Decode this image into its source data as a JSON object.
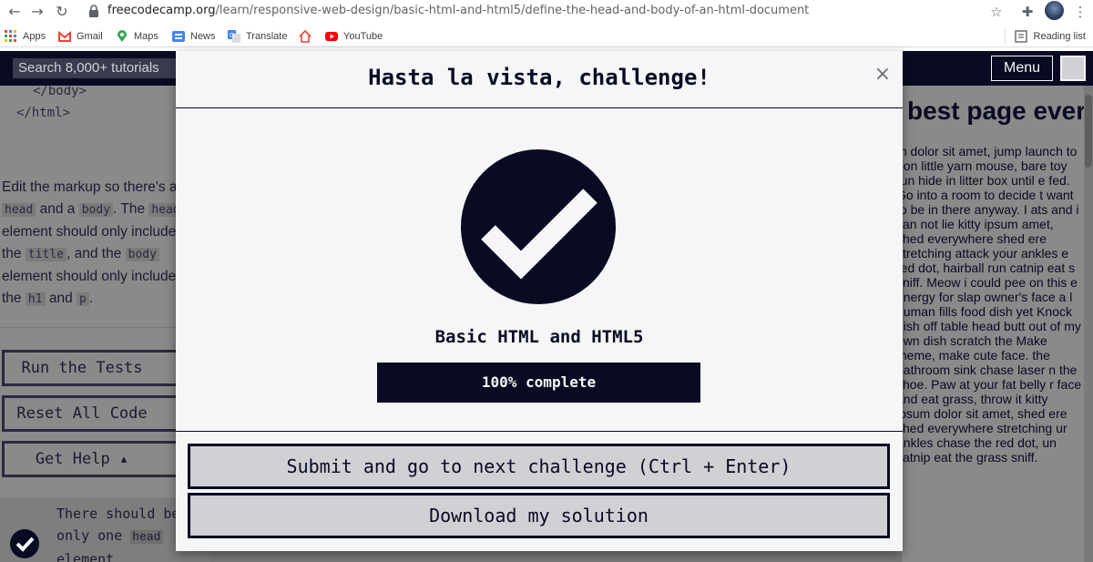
{
  "browser": {
    "url_host": "freecodecamp.org",
    "url_path": "/learn/responsive-web-design/basic-html-and-html5/define-the-head-and-body-of-an-html-document",
    "bookmarks": [
      {
        "label": "Apps",
        "icon": "apps-grid-icon"
      },
      {
        "label": "Gmail",
        "icon": "gmail-icon"
      },
      {
        "label": "Maps",
        "icon": "maps-pin-icon"
      },
      {
        "label": "News",
        "icon": "news-icon"
      },
      {
        "label": "Translate",
        "icon": "translate-icon"
      },
      {
        "label": "",
        "icon": "home-icon"
      },
      {
        "label": "YouTube",
        "icon": "youtube-icon"
      }
    ],
    "reading_list": "Reading list"
  },
  "fcc": {
    "search_placeholder": "Search 8,000+ tutorials",
    "menu_label": "Menu",
    "code_lines": [
      "</body>",
      "</html>"
    ],
    "instructions": {
      "t1": "Edit the markup so there's a ",
      "c1": "head",
      "t2": " and a ",
      "c2": "body",
      "t3": ". The ",
      "c3": "head",
      "t4": " element should only include the ",
      "c4": "title",
      "t5": ", and the ",
      "c5": "body",
      "t6": " element should only include the ",
      "c6": "h1",
      "t7": " and ",
      "c7": "p",
      "t8": "."
    },
    "buttons": {
      "run_tests": "Run the Tests",
      "reset": "Reset All Code",
      "help": "Get Help ▴"
    },
    "test": {
      "t1": "There should be only one ",
      "c1": "head",
      "t2": " element"
    },
    "preview_heading": "best page ever",
    "preview_paragraph": "m dolor sit amet, jump launch to pon little yarn mouse, bare toy run hide in litter box until e fed. Go into a room to decide t want to be in there anyway. I ats and i can not lie kitty ipsum amet, shed everywhere shed ere stretching attack your ankles e red dot, hairball run catnip eat s sniff. Meow i could pee on this e energy for slap owner's face a l human fills food dish yet Knock dish off table head butt out of my own dish scratch the Make meme, make cute face. the bathroom sink chase laser n the shoe. Paw at your fat belly r face and eat grass, throw it kitty ipsum dolor sit amet, shed ere shed everywhere stretching ur ankles chase the red dot, un catnip eat the grass sniff."
  },
  "modal": {
    "title": "Hasta la vista, challenge!",
    "close_symbol": "×",
    "block_title": "Basic HTML and HTML5",
    "progress_percent": 100,
    "progress_text": "100% complete",
    "submit_label": "Submit and go to next challenge (Ctrl + Enter)",
    "download_label": "Download my solution"
  },
  "colors": {
    "fcc_dark": "#0a0a23",
    "modal_bg": "#f5f6f7",
    "button_bg": "#d0d0d5"
  }
}
